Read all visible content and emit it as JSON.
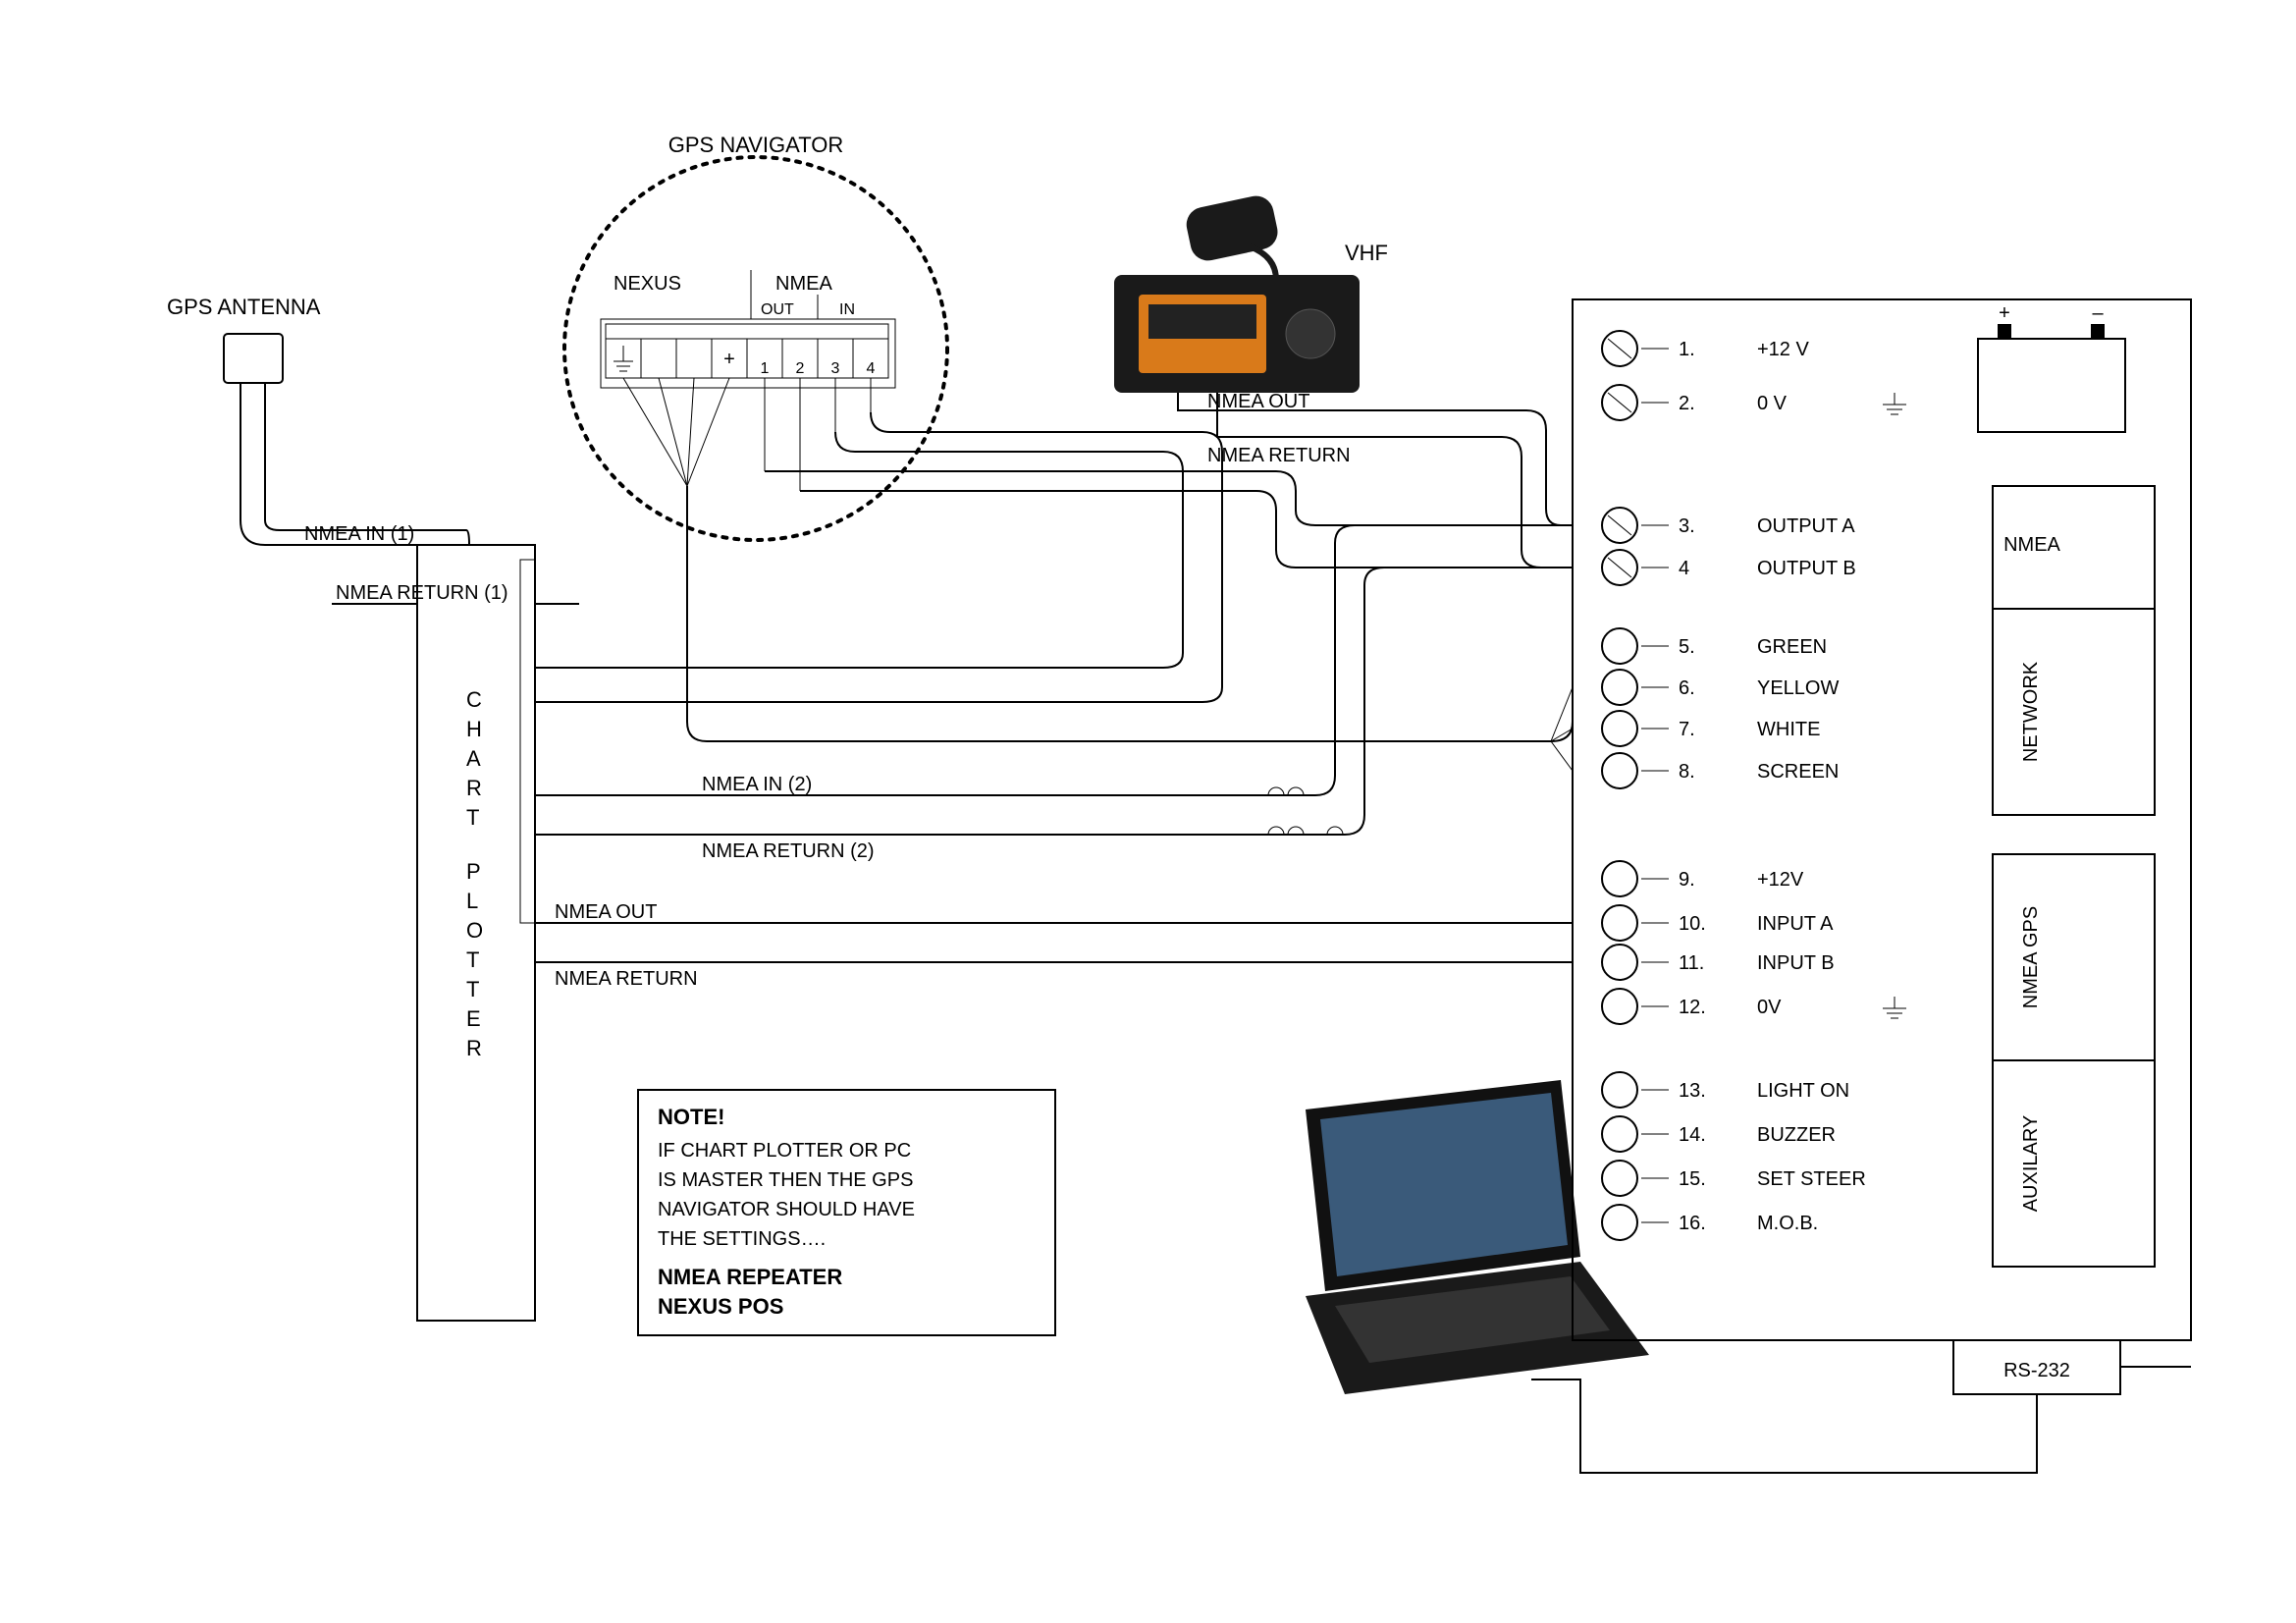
{
  "labels": {
    "gps_antenna": "GPS ANTENNA",
    "gps_navigator": "GPS NAVIGATOR",
    "nexus": "NEXUS",
    "nmea": "NMEA",
    "out": "OUT",
    "in": "IN",
    "vhf": "VHF",
    "nmea_out": "NMEA OUT",
    "nmea_return": "NMEA RETURN",
    "nmea_in_1": "NMEA IN (1)",
    "nmea_return_1": "NMEA RETURN (1)",
    "nmea_in_2": "NMEA IN (2)",
    "nmea_return_2": "NMEA RETURN (2)",
    "chart_plotter": "CHART PLOTTER",
    "rs232": "RS-232"
  },
  "note": {
    "title": "NOTE!",
    "l1": "IF CHART PLOTTER OR PC",
    "l2": "IS MASTER THEN THE GPS",
    "l3": "NAVIGATOR SHOULD HAVE",
    "l4": "THE SETTINGS….",
    "b1": "NMEA REPEATER",
    "b2": "NEXUS POS"
  },
  "navigator_pins": [
    "1",
    "2",
    "3",
    "4"
  ],
  "terminal": {
    "groups": {
      "nmea": "NMEA",
      "network": "NETWORK",
      "nmea_gps": "NMEA GPS",
      "auxilary": "AUXILARY"
    },
    "pins": [
      {
        "n": "1.",
        "label": "+12 V",
        "shape": "screw"
      },
      {
        "n": "2.",
        "label": "0 V",
        "shape": "screw",
        "gnd": true
      },
      {
        "n": "3.",
        "label": "OUTPUT A",
        "shape": "screw"
      },
      {
        "n": "4",
        "label": "OUTPUT B",
        "shape": "screw"
      },
      {
        "n": "5.",
        "label": "GREEN",
        "shape": "ring"
      },
      {
        "n": "6.",
        "label": "YELLOW",
        "shape": "ring"
      },
      {
        "n": "7.",
        "label": "WHITE",
        "shape": "ring"
      },
      {
        "n": "8.",
        "label": "SCREEN",
        "shape": "ring"
      },
      {
        "n": "9.",
        "label": "+12V",
        "shape": "ring"
      },
      {
        "n": "10.",
        "label": "INPUT A",
        "shape": "ring"
      },
      {
        "n": "11.",
        "label": "INPUT B",
        "shape": "ring"
      },
      {
        "n": "12.",
        "label": "0V",
        "shape": "ring",
        "gnd": true
      },
      {
        "n": "13.",
        "label": "LIGHT ON",
        "shape": "ring"
      },
      {
        "n": "14.",
        "label": "BUZZER",
        "shape": "ring"
      },
      {
        "n": "15.",
        "label": "SET STEER",
        "shape": "ring"
      },
      {
        "n": "16.",
        "label": "M.O.B.",
        "shape": "ring"
      }
    ]
  },
  "battery": {
    "plus": "+",
    "minus": "–"
  }
}
